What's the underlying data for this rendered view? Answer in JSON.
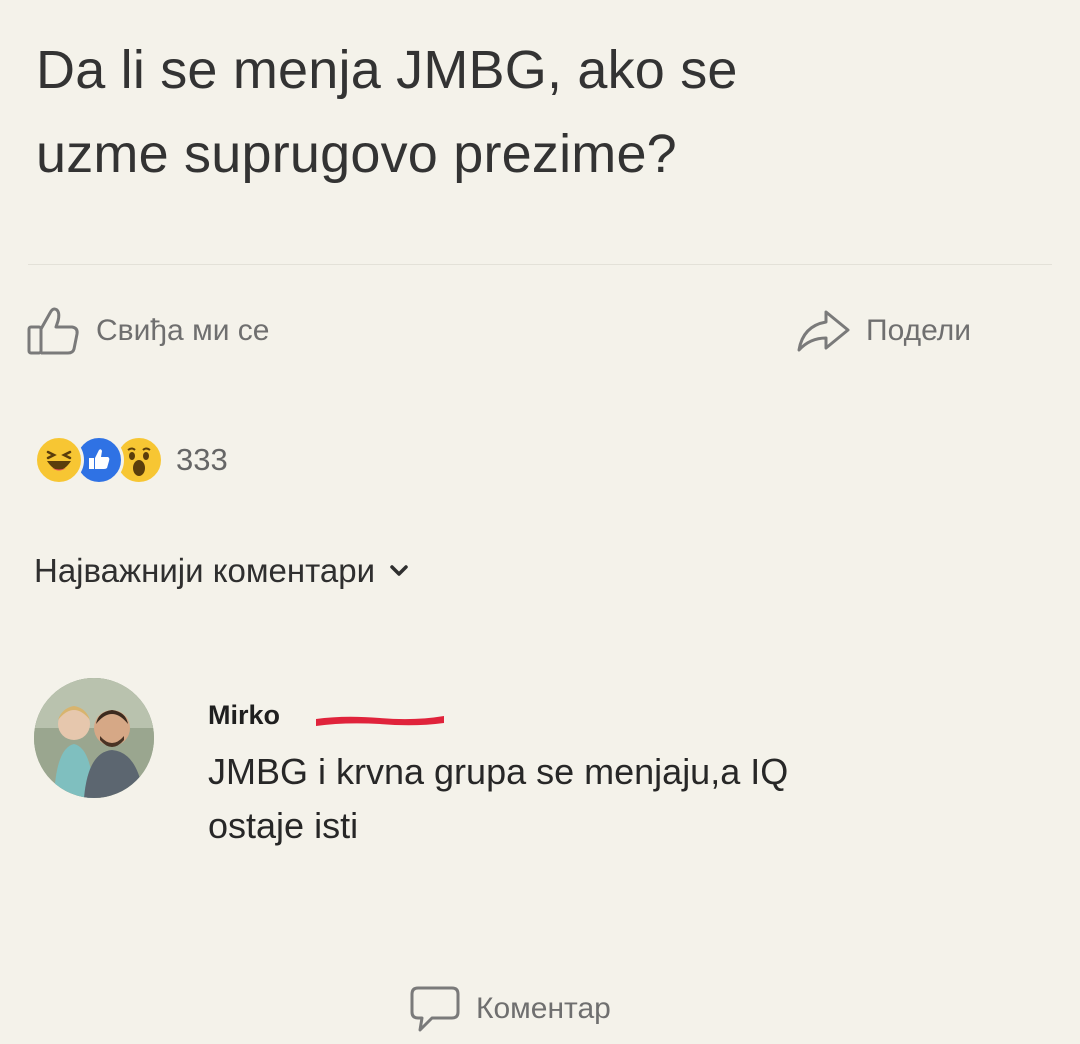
{
  "post": {
    "text_line1": "Da li se menja JMBG, ako se",
    "text_line2": "uzme suprugovo prezime?"
  },
  "actions": {
    "like_label": "Свиђа ми се",
    "comment_label": "Коментар",
    "share_label": "Подели"
  },
  "reactions": {
    "icons": [
      "haha-reaction-icon",
      "like-reaction-icon",
      "wow-reaction-icon"
    ],
    "count": "333"
  },
  "comments_sort": {
    "label": "Најважнији коментари"
  },
  "comment": {
    "author": "Mirko",
    "text_line1": "JMBG i krvna grupa se menjaju,a IQ",
    "text_line2": "ostaje isti"
  },
  "colors": {
    "background": "#f4f2ea",
    "muted_text": "#6f6f6f",
    "like_blue": "#2f72e4",
    "reaction_yellow": "#f7c633",
    "redaction_red": "#e0233b"
  }
}
